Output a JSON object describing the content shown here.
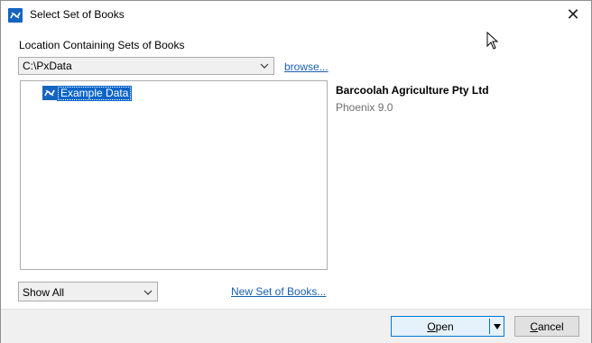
{
  "window": {
    "title": "Select Set of Books"
  },
  "location": {
    "label": "Location Containing Sets of Books",
    "selected": "C:\\PxData",
    "browse_label": "browse..."
  },
  "tree": {
    "items": [
      {
        "label": "Example Data",
        "selected": true
      }
    ]
  },
  "details": {
    "company": "Barcoolah Agriculture Pty Ltd",
    "version": "Phoenix 9.0"
  },
  "filter": {
    "selected": "Show All"
  },
  "new_set_label": "New Set of Books...",
  "buttons": {
    "open": "Open",
    "cancel": "Cancel"
  },
  "colors": {
    "accent": "#0078d7",
    "link": "#1a5fb4",
    "selection": "#0a64c8",
    "footer": "#f0f0f0"
  },
  "icons": {
    "app": "phoenix-logo-icon",
    "close": "close-icon",
    "dropdown": "chevron-down-icon"
  }
}
